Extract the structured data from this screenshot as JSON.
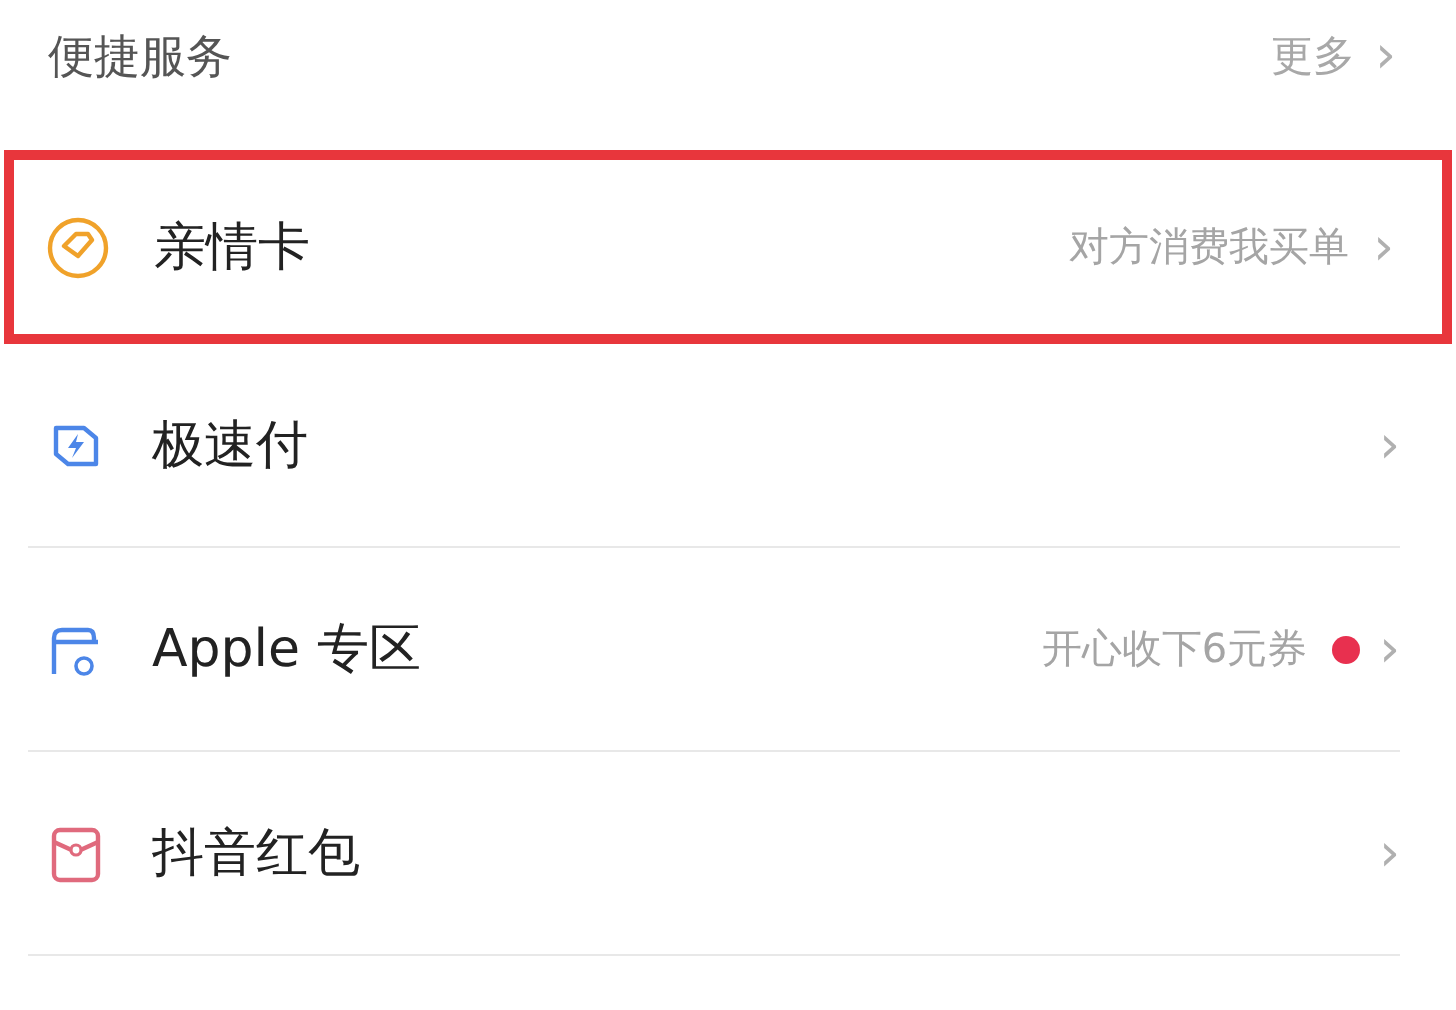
{
  "section": {
    "title": "便捷服务",
    "more": "更多",
    "more_chevron": "›"
  },
  "items": [
    {
      "kind": "family-card",
      "title": "亲情卡",
      "hint": "对方消费我买单",
      "highlighted": true,
      "chevron": "›"
    },
    {
      "kind": "fast-pay",
      "title": "极速付",
      "highlighted": false,
      "chevron": "›"
    },
    {
      "kind": "apple",
      "title": "Apple 专区",
      "hint": "开心收下6元券",
      "color": "#e8304f",
      "highlighted": false,
      "chevron": "›"
    },
    {
      "kind": "red-packet",
      "title": "抖音红包",
      "highlighted": false,
      "chevron": "›"
    }
  ]
}
